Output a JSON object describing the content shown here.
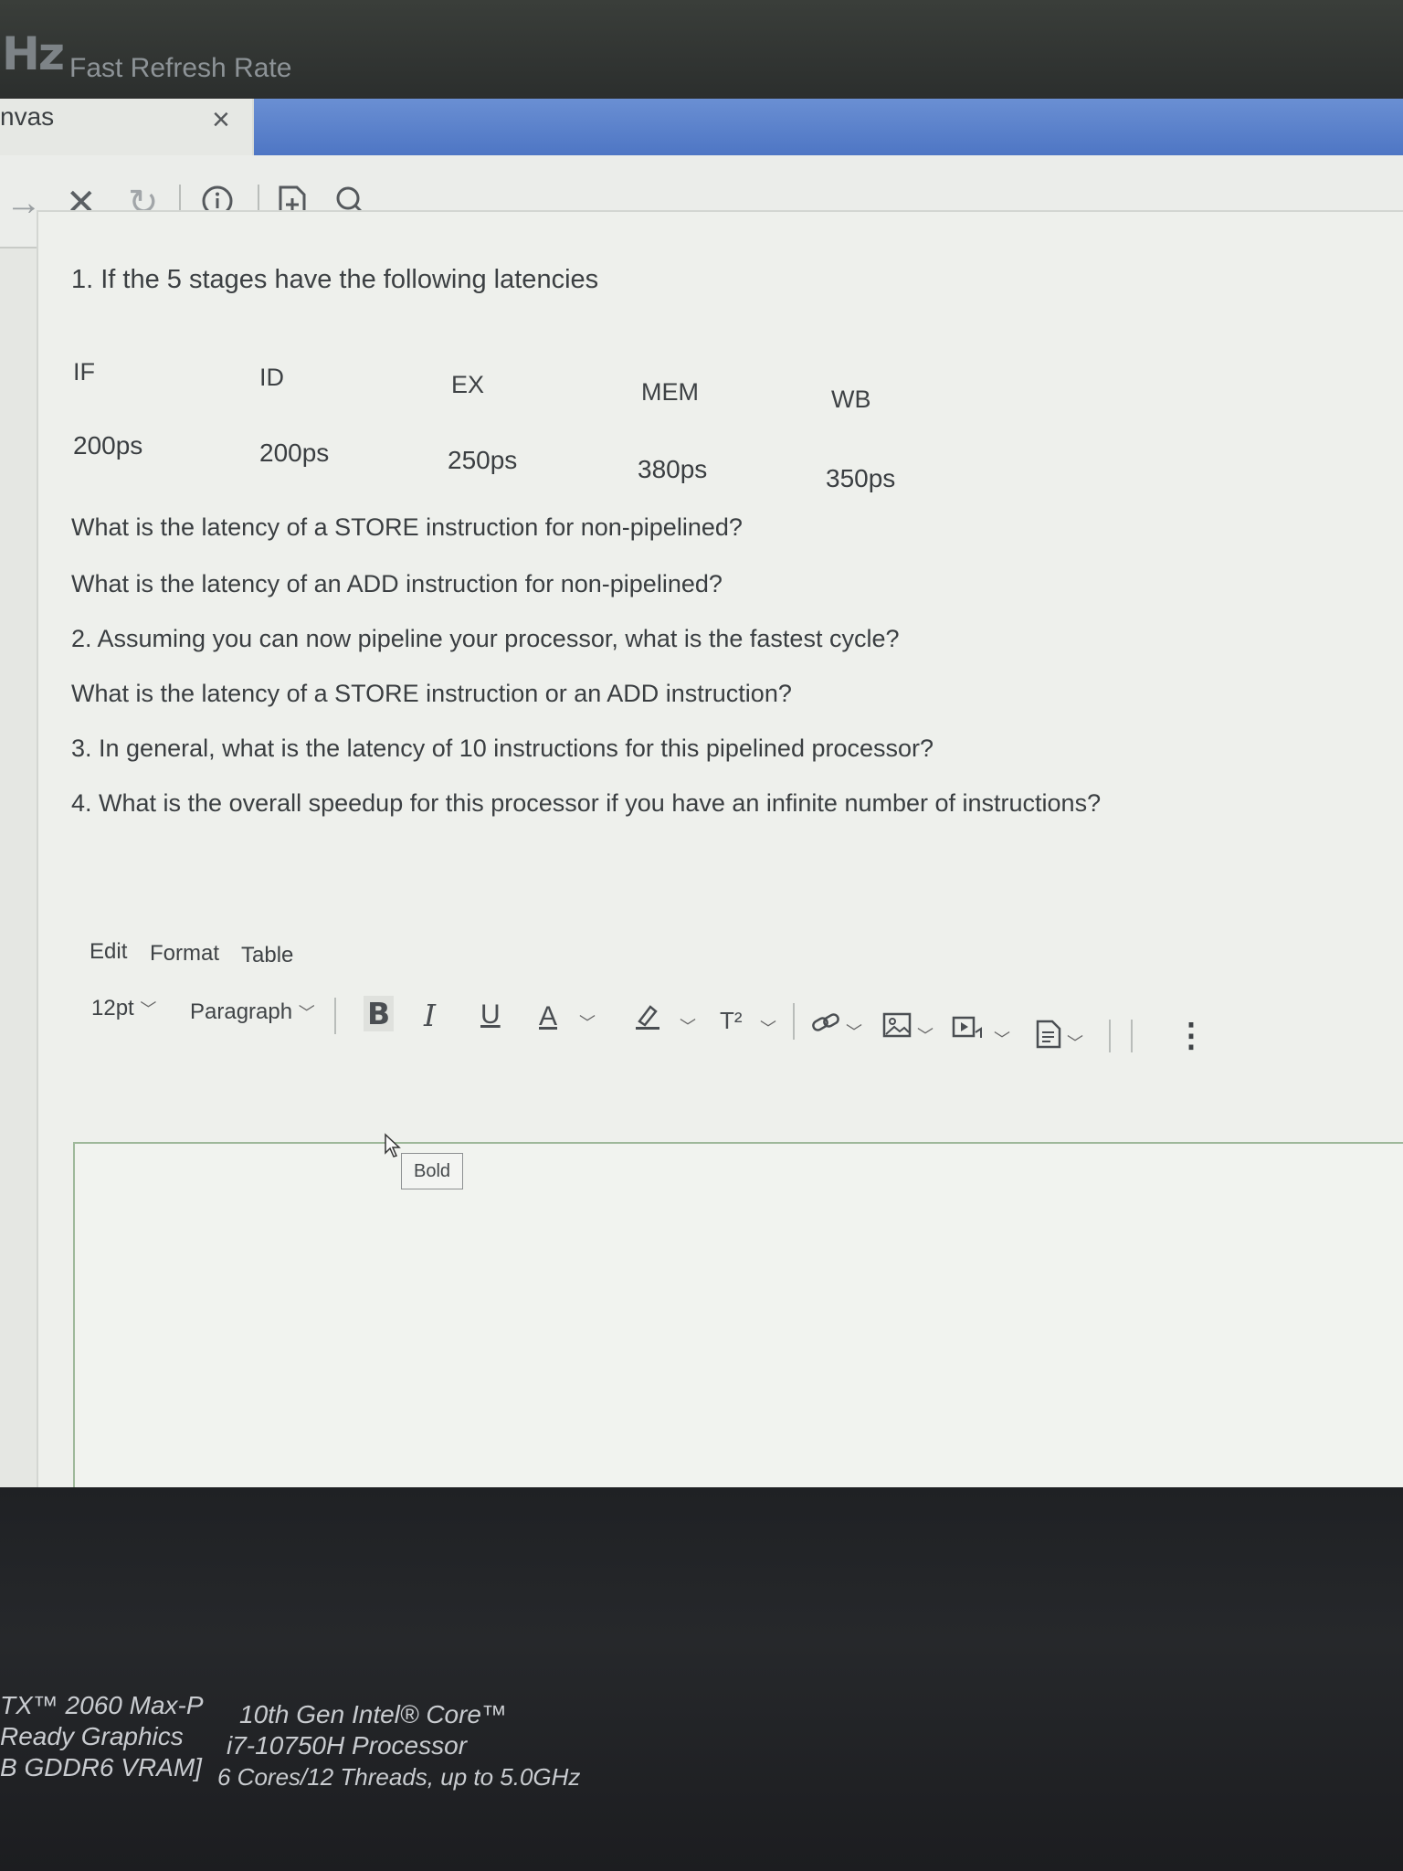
{
  "bezel": {
    "logo": "Hz",
    "tagline": "Fast Refresh Rate"
  },
  "browser": {
    "tab_title": "nvas",
    "tab_close": "×",
    "nav_forward": "→",
    "nav_stop": "✕",
    "nav_reload": "↻",
    "icons": [
      "forward-icon",
      "stop-icon",
      "reload-icon",
      "info-icon",
      "add-page-icon",
      "search-icon"
    ]
  },
  "question": {
    "intro": "1. If the 5 stages have the following latencies",
    "stages": [
      "IF",
      "ID",
      "EX",
      "MEM",
      "WB"
    ],
    "latencies": [
      "200ps",
      "200ps",
      "250ps",
      "380ps",
      "350ps"
    ],
    "lines": [
      "What is the latency of a STORE instruction for non-pipelined?",
      "What is the latency of an ADD instruction for non-pipelined?",
      "2. Assuming you can now pipeline your processor, what is the fastest cycle?",
      "What is the latency of a STORE instruction or an ADD instruction?",
      "3. In general, what is the latency of 10 instructions for this pipelined processor?",
      "4. What is the overall speedup for this processor if you have an infinite number of instructions?"
    ]
  },
  "editor": {
    "menu": [
      "Edit",
      "Format",
      "Table"
    ],
    "font_size": "12pt",
    "block_format": "Paragraph",
    "bold": "B",
    "italic": "I",
    "underline": "U",
    "text_color": "A",
    "superscript": "T²",
    "tooltip": "Bold",
    "more": "⋮",
    "toolbar_icons": [
      "bold-icon",
      "italic-icon",
      "underline-icon",
      "text-color-icon",
      "highlight-icon",
      "superscript-icon",
      "link-icon",
      "image-icon",
      "media-icon",
      "document-icon",
      "more-icon"
    ]
  },
  "sticker": {
    "gpu_line1": "TX™ 2060 Max-P",
    "gpu_line2": "Ready Graphics",
    "gpu_line3": "B GDDR6 VRAM]",
    "cpu_line1": "10th Gen Intel® Core™",
    "cpu_line2": "i7-10750H Processor",
    "cpu_line3": "6 Cores/12 Threads, up to 5.0GHz"
  }
}
